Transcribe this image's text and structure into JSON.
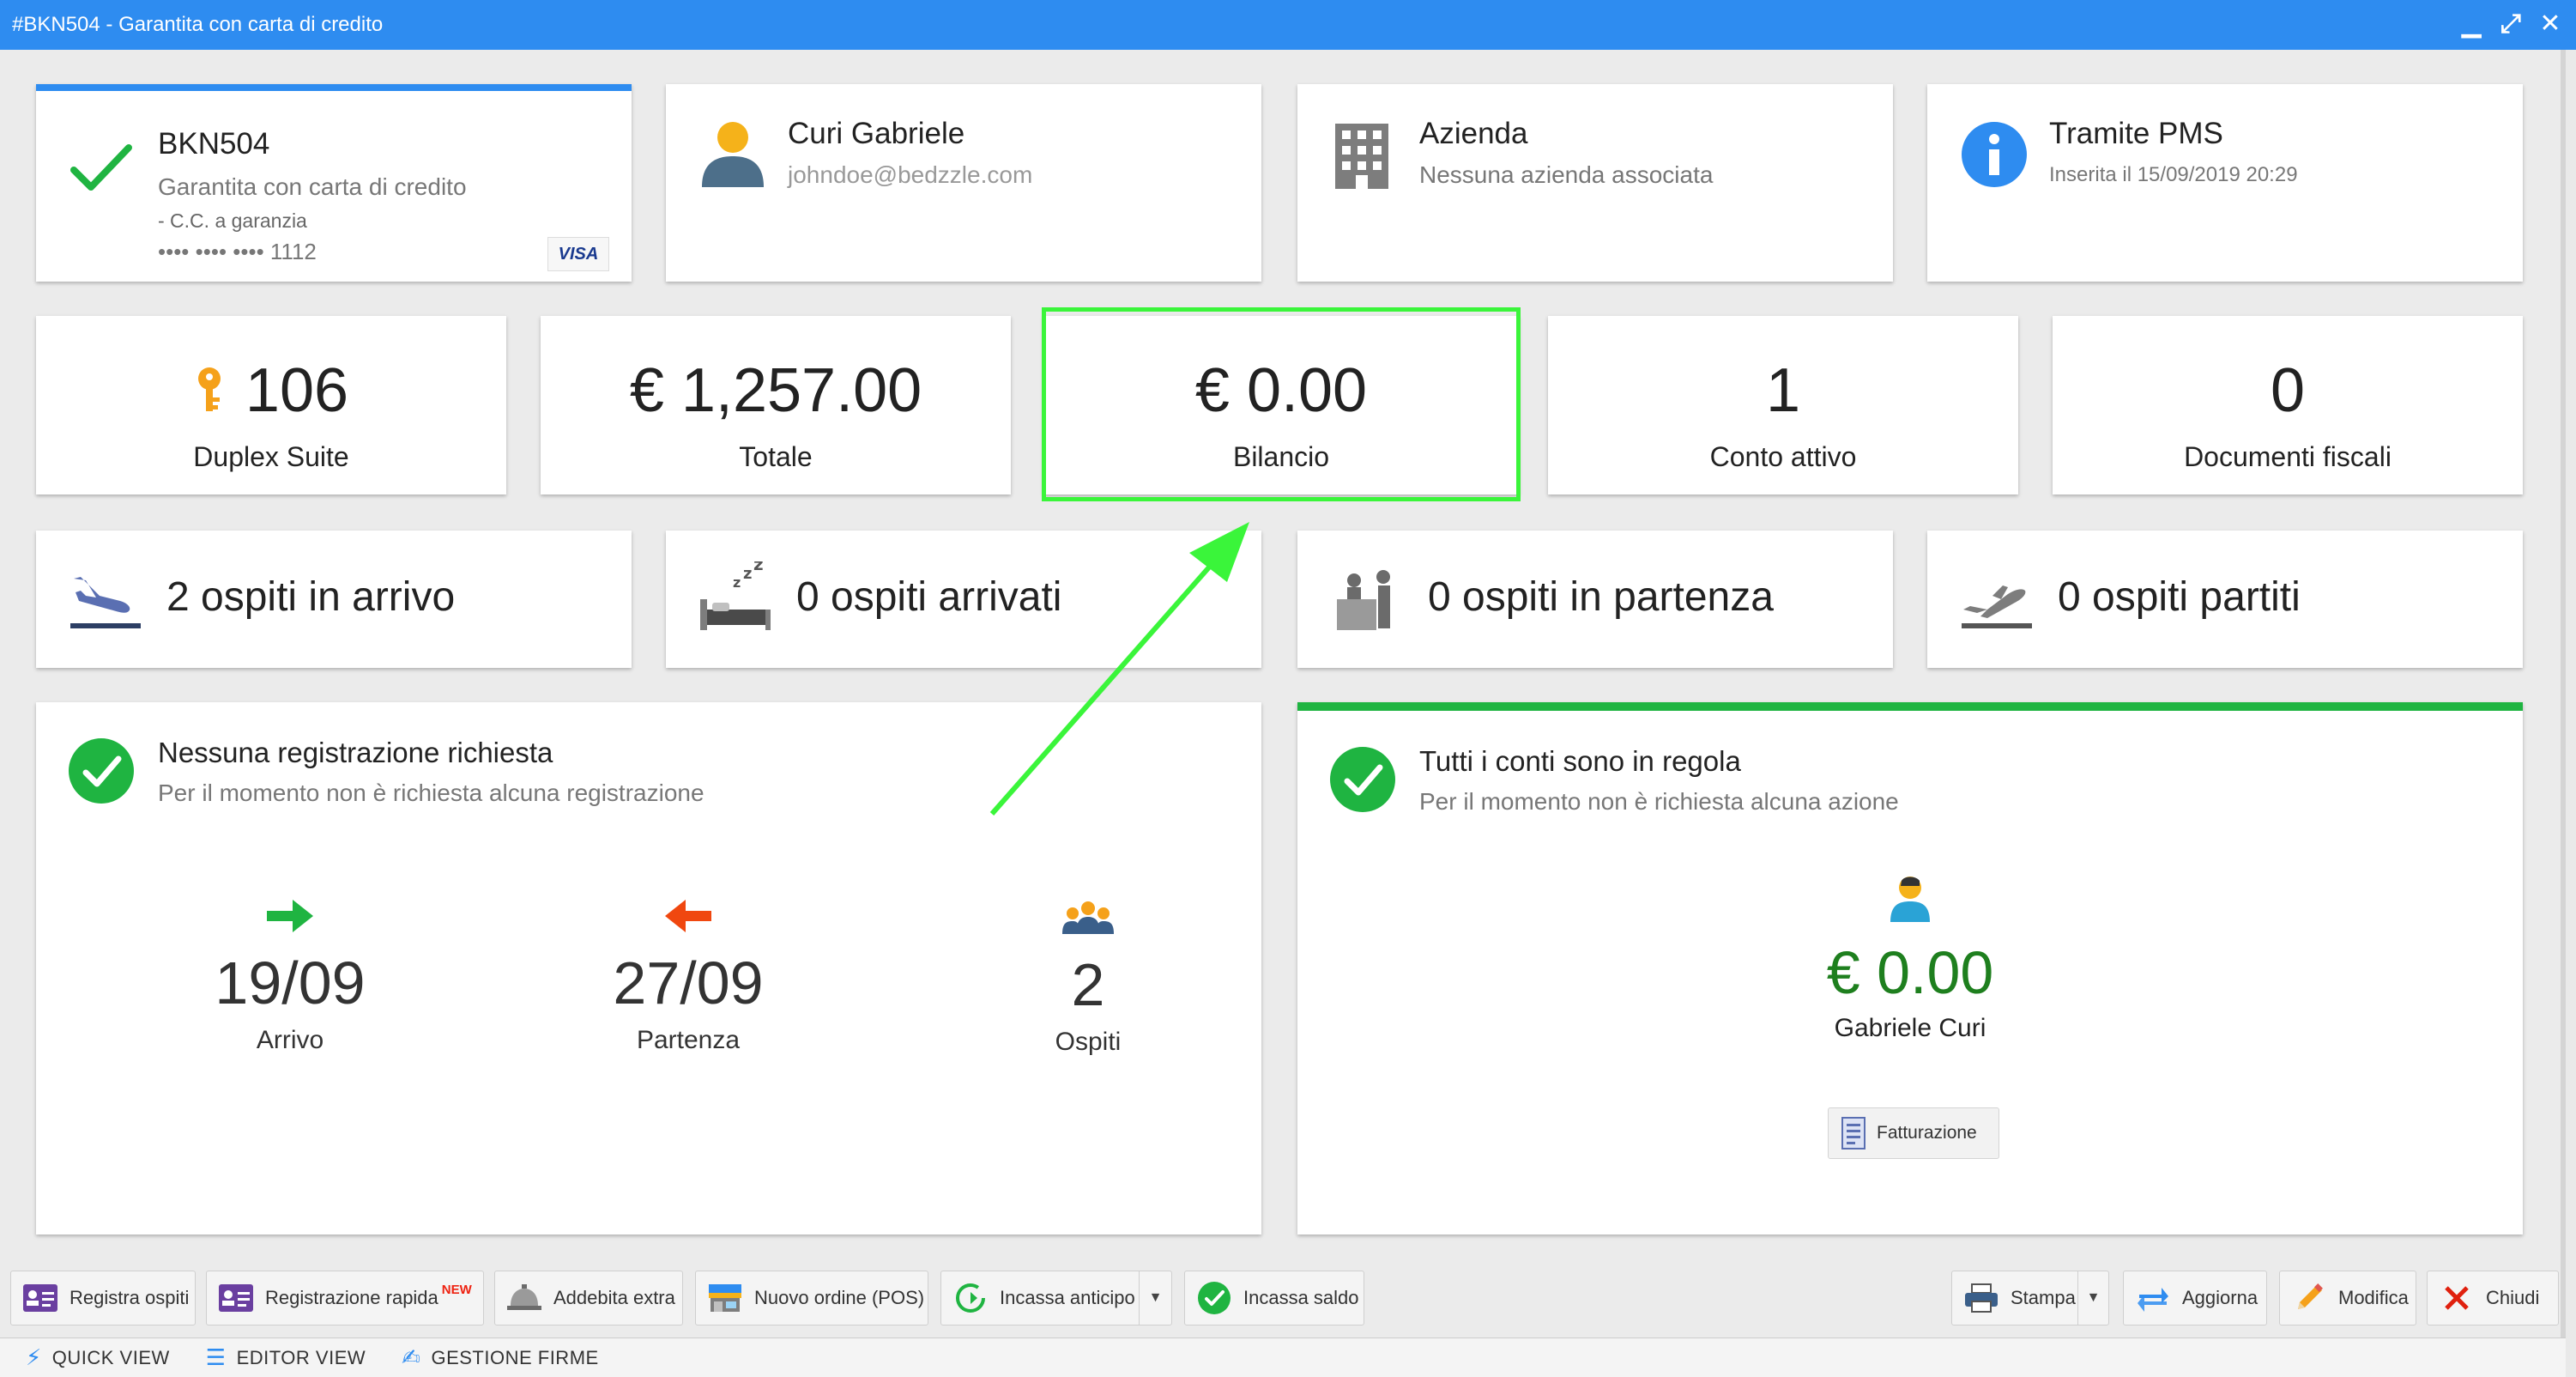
{
  "window": {
    "title": "#BKN504 - Garantita con carta di credito"
  },
  "booking": {
    "code": "BKN504",
    "status": "Garantita con carta di credito",
    "guarantee": "- C.C. a garanzia",
    "card_mask": "•••• •••• •••• 1112",
    "card_brand": "VISA"
  },
  "customer": {
    "name": "Curi Gabriele",
    "email": "johndoe@bedzzle.com"
  },
  "company": {
    "title": "Azienda",
    "subtitle": "Nessuna azienda associata"
  },
  "source": {
    "title": "Tramite PMS",
    "subtitle": "Inserita il 15/09/2019 20:29"
  },
  "stats": {
    "room": {
      "value": "106",
      "label": "Duplex Suite"
    },
    "total": {
      "value": "€ 1,257.00",
      "label": "Totale"
    },
    "balance": {
      "value": "€ 0.00",
      "label": "Bilancio"
    },
    "accounts": {
      "value": "1",
      "label": "Conto attivo"
    },
    "fiscal": {
      "value": "0",
      "label": "Documenti fiscali"
    }
  },
  "guests": {
    "arriving": "2 ospiti in arrivo",
    "arrived": "0 ospiti arrivati",
    "departing": "0 ospiti in partenza",
    "departed": "0 ospiti partiti"
  },
  "registration": {
    "title": "Nessuna registrazione richiesta",
    "subtitle": "Per il momento non è richiesta alcuna registrazione",
    "arrival": {
      "value": "19/09",
      "label": "Arrivo"
    },
    "departure": {
      "value": "27/09",
      "label": "Partenza"
    },
    "guests": {
      "value": "2",
      "label": "Ospiti"
    }
  },
  "accounts_status": {
    "title": "Tutti i conti sono in regola",
    "subtitle": "Per il momento non è richiesta alcuna azione",
    "amount": "€ 0.00",
    "person": "Gabriele Curi",
    "invoice_button": "Fatturazione"
  },
  "toolbar": {
    "register_guests": "Registra ospiti",
    "quick_registration": "Registrazione rapida",
    "new_badge": "NEW",
    "charge_extra": "Addebita extra",
    "new_order": "Nuovo ordine (POS)",
    "collect_advance": "Incassa anticipo",
    "collect_balance": "Incassa saldo",
    "print": "Stampa",
    "refresh": "Aggiorna",
    "edit": "Modifica",
    "close": "Chiudi"
  },
  "tabs": {
    "quick_view": "QUICK VIEW",
    "editor_view": "EDITOR VIEW",
    "signatures": "GESTIONE FIRME"
  },
  "colors": {
    "titlebar": "#2e8cf0",
    "accent_blue": "#2e8cf0",
    "success_green": "#1fb441",
    "balance_green": "#1e7f1e",
    "alert_red": "#e0200e",
    "annotation_green": "#3af53a"
  }
}
